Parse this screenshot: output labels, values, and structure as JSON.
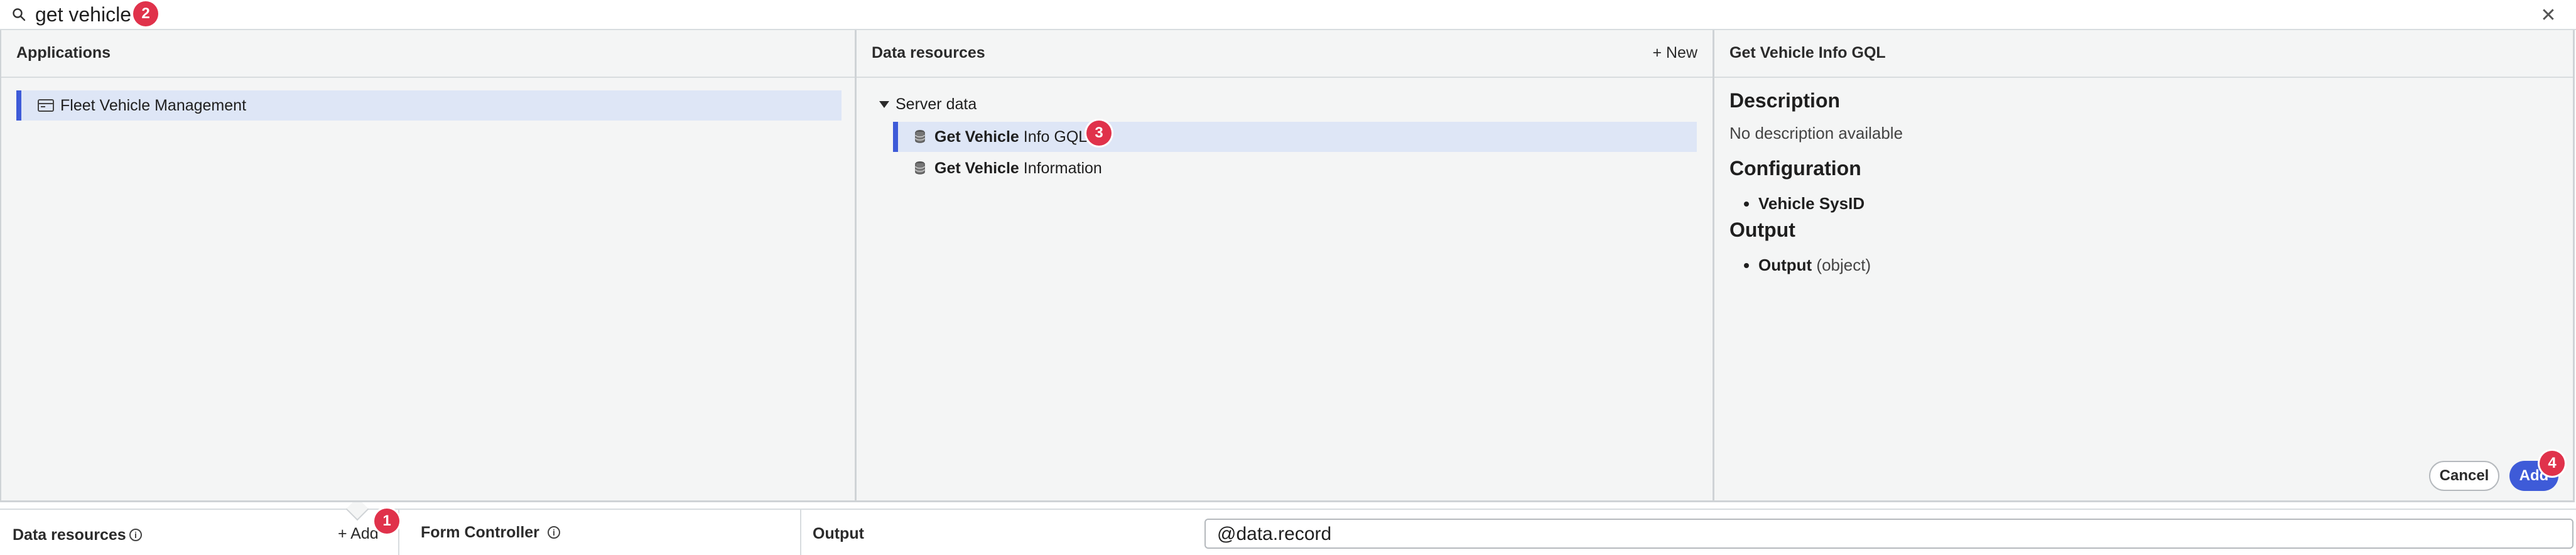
{
  "search": {
    "query": "get vehicle"
  },
  "applications": {
    "header": "Applications",
    "items": [
      {
        "label": "Fleet Vehicle Management"
      }
    ]
  },
  "data_resources": {
    "header": "Data resources",
    "new_label": "+ New",
    "group": "Server data",
    "items": [
      {
        "bold": "Get Vehicle",
        "rest": " Info GQL"
      },
      {
        "bold": "Get Vehicle",
        "rest": " Information"
      }
    ]
  },
  "detail": {
    "header": "Get Vehicle Info GQL",
    "description_heading": "Description",
    "description_text": "No description available",
    "configuration_heading": "Configuration",
    "configuration_items": [
      "Vehicle SysID"
    ],
    "output_heading": "Output",
    "output_item_bold": "Output",
    "output_item_rest": " (object)",
    "cancel_label": "Cancel",
    "add_label": "Add"
  },
  "bottom": {
    "data_resources_label": "Data resources",
    "add_label": "+ Add",
    "form_controller_label": "Form Controller",
    "output_label": "Output",
    "output_value": "@data.record"
  },
  "badges": [
    "1",
    "2",
    "3",
    "4"
  ],
  "colors": {
    "accent": "#3e5bd8",
    "badge": "#e0324b",
    "selected_row": "#dee6f6"
  }
}
